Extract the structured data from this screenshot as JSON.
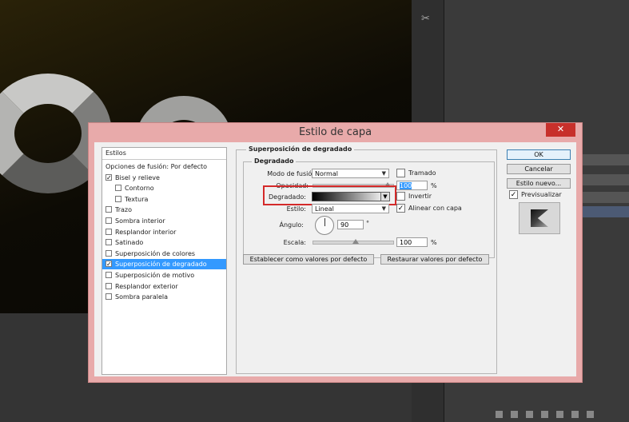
{
  "dialog": {
    "title": "Estilo de capa",
    "close_label": "✕"
  },
  "styles": {
    "header": "Estilos",
    "items": [
      {
        "label": "Opciones de fusión: Por defecto",
        "checkbox": false,
        "checked": false,
        "selected": false
      },
      {
        "label": "Bisel y relieve",
        "checkbox": true,
        "checked": true,
        "selected": false
      },
      {
        "label": "Contorno",
        "checkbox": true,
        "checked": false,
        "selected": false
      },
      {
        "label": "Textura",
        "checkbox": true,
        "checked": false,
        "selected": false
      },
      {
        "label": "Trazo",
        "checkbox": true,
        "checked": false,
        "selected": false
      },
      {
        "label": "Sombra interior",
        "checkbox": true,
        "checked": false,
        "selected": false
      },
      {
        "label": "Resplandor interior",
        "checkbox": true,
        "checked": false,
        "selected": false
      },
      {
        "label": "Satinado",
        "checkbox": true,
        "checked": false,
        "selected": false
      },
      {
        "label": "Superposición de colores",
        "checkbox": true,
        "checked": false,
        "selected": false
      },
      {
        "label": "Superposición de degradado",
        "checkbox": true,
        "checked": true,
        "selected": true
      },
      {
        "label": "Superposición de motivo",
        "checkbox": true,
        "checked": false,
        "selected": false
      },
      {
        "label": "Resplandor exterior",
        "checkbox": true,
        "checked": false,
        "selected": false
      },
      {
        "label": "Sombra paralela",
        "checkbox": true,
        "checked": false,
        "selected": false
      }
    ]
  },
  "gradient_overlay": {
    "group_title": "Superposición de degradado",
    "subgroup_title": "Degradado",
    "blend_mode_label": "Modo de fusión:",
    "blend_mode_value": "Normal",
    "dither_label": "Tramado",
    "opacity_label": "Opacidad:",
    "opacity_value": "100",
    "opacity_unit": "%",
    "gradient_label": "Degradado:",
    "reverse_label": "Invertir",
    "style_label": "Estilo:",
    "style_value": "Lineal",
    "align_label": "Alinear con capa",
    "angle_label": "Ángulo:",
    "angle_value": "90",
    "angle_unit": "°",
    "scale_label": "Escala:",
    "scale_value": "100",
    "scale_unit": "%",
    "make_default_label": "Establecer como valores por defecto",
    "reset_default_label": "Restaurar valores por defecto"
  },
  "buttons": {
    "ok": "OK",
    "cancel": "Cancelar",
    "new_style": "Estilo nuevo...",
    "preview_label": "Previsualizar"
  },
  "colors": {
    "dialog_frame": "#e8aaaa",
    "close_button": "#c7302b",
    "selection": "#3399ff",
    "highlight_box": "#d42a2a"
  }
}
